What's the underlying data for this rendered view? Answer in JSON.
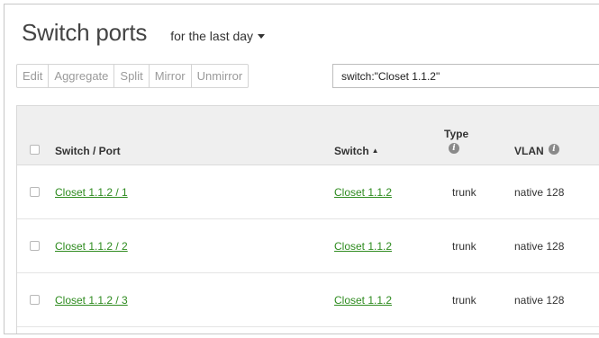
{
  "header": {
    "title": "Switch ports",
    "timespan_label": "for the last day"
  },
  "toolbar": {
    "buttons": [
      "Edit",
      "Aggregate",
      "Split",
      "Mirror",
      "Unmirror"
    ]
  },
  "search": {
    "value": "switch:\"Closet 1.1.2\""
  },
  "table": {
    "columns": {
      "switch_port": "Switch / Port",
      "switch": "Switch",
      "type": "Type",
      "vlan": "VLAN"
    },
    "sort": {
      "column": "switch",
      "direction": "ascending"
    },
    "rows": [
      {
        "switch_port": "Closet 1.1.2 / 1",
        "switch": "Closet 1.1.2",
        "type": "trunk",
        "vlan": "native 128"
      },
      {
        "switch_port": "Closet 1.1.2 / 2",
        "switch": "Closet 1.1.2",
        "type": "trunk",
        "vlan": "native 128"
      },
      {
        "switch_port": "Closet 1.1.2 / 3",
        "switch": "Closet 1.1.2",
        "type": "trunk",
        "vlan": "native 128"
      }
    ]
  },
  "icons": {
    "sort": "sort-ascending-icon",
    "info": "info-icon",
    "timespan": "chevron-down-icon"
  },
  "colors": {
    "link": "#2e8b1f",
    "header_bg": "#efefef",
    "disabled_text": "#9a9a9a"
  }
}
